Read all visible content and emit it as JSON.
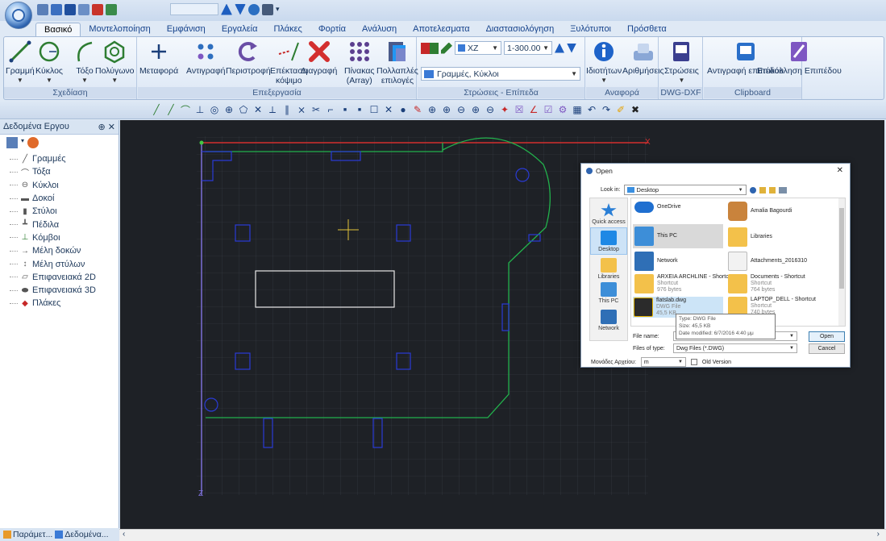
{
  "quick_access": {
    "items": [
      "app-icon",
      "new-icon",
      "save-icon",
      "building-icon",
      "arrow-icon",
      "network-icon"
    ]
  },
  "tabs": [
    "Βασικό",
    "Μοντελοποίηση",
    "Εμφάνιση",
    "Εργαλεία",
    "Πλάκες",
    "Φορτία",
    "Ανάλυση",
    "Αποτελεσματα",
    "Διαστασιολόγηση",
    "Ξυλότυποι",
    "Πρόσθετα"
  ],
  "ribbon": {
    "design": {
      "label": "Σχεδίαση",
      "buttons": [
        "Γραμμή",
        "Κύκλος",
        "Τόξο",
        "Πολύγωνο"
      ]
    },
    "edit": {
      "label": "Επεξεργασία",
      "buttons": [
        "Μεταφορά",
        "Αντιγραφή",
        "Περιστροφή",
        "Επέκταση",
        "Διαγραφή",
        "Πίνακας",
        "Πολλαπλές"
      ],
      "sub": {
        "extend": "κόψιμο",
        "array": "(Array)",
        "multi": "επιλογές"
      }
    },
    "layers": {
      "label": "Στρώσεις - Επίπεδα",
      "plane": "XZ",
      "scale": "1-300.00",
      "layer": "Γραμμές, Κύκλοι"
    },
    "reference": {
      "label": "Αναφορά",
      "buttons": [
        "Ιδιοτήτων",
        "Αριθμήσεις"
      ]
    },
    "dxf": {
      "label": "DWG-DXF",
      "buttons": [
        "Στρώσεις"
      ]
    },
    "clipboard": {
      "label": "Clipboard",
      "buttons": [
        "Αντιγραφή επιπέδου",
        "Επικόλληση Επιπέδου"
      ]
    }
  },
  "panel": {
    "title": "Δεδομένα Εργου",
    "pin": "⊕ ✕",
    "items": [
      "Γραμμές",
      "Τόξα",
      "Κύκλοι",
      "Δοκοί",
      "Στύλοι",
      "Πέδιλα",
      "Κόμβοι",
      "Μέλη δοκών",
      "Μέλη στύλων",
      "Επιφανειακά 2D",
      "Επιφανειακά 3D",
      "Πλάκες"
    ]
  },
  "bottom_tabs": [
    "Παράμετ...",
    "Δεδομένα..."
  ],
  "canvas": {
    "x_label": "X",
    "z_label": "Z"
  },
  "dialog": {
    "title": "Open",
    "look_in_label": "Look in:",
    "look_in_value": "Desktop",
    "places": [
      "Quick access",
      "Desktop",
      "Libraries",
      "This PC",
      "Network"
    ],
    "files": [
      {
        "name": "OneDrive",
        "sub": ""
      },
      {
        "name": "Amalia Bagourdi",
        "sub": ""
      },
      {
        "name": "This PC",
        "sub": ""
      },
      {
        "name": "Libraries",
        "sub": ""
      },
      {
        "name": "Network",
        "sub": ""
      },
      {
        "name": "Attachments_2016310",
        "sub": ""
      },
      {
        "name": "ARXEIA ARCHLINE - Shortcut",
        "sub": "Shortcut\n976 bytes"
      },
      {
        "name": "Documents - Shortcut",
        "sub": "Shortcut\n764 bytes"
      },
      {
        "name": "flatslab.dwg",
        "sub": "DWG File\n45,5 KB"
      },
      {
        "name": "LAPTOP_DELL - Shortcut",
        "sub": "Shortcut\n740 bytes"
      }
    ],
    "tooltip": [
      "Type: DWG File",
      "Size: 45,5 KB",
      "Date modified: 6/7/2016 4:40 μμ"
    ],
    "file_name_label": "File name:",
    "file_type_label": "Files of type:",
    "file_type_value": "Dwg Files (*.DWG)",
    "units_label": "Μονάδες Αρχείου:",
    "units_value": "m",
    "old_version": "Old Version",
    "open_btn": "Open",
    "cancel_btn": "Cancel"
  }
}
